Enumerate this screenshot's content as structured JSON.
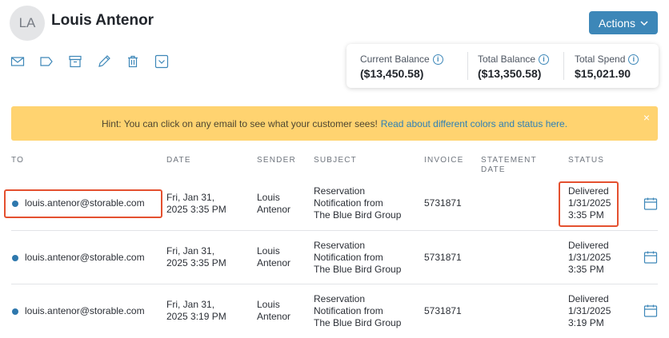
{
  "customer": {
    "initials": "LA",
    "name": "Louis Antenor"
  },
  "actions_label": "Actions",
  "toolbar": {
    "icons": [
      "mail-icon",
      "tag-icon",
      "archive-icon",
      "edit-pencil-icon",
      "trash-icon",
      "dropdown-checkbox-icon"
    ]
  },
  "balances": {
    "current": {
      "label": "Current Balance",
      "value": "($13,450.58)"
    },
    "total": {
      "label": "Total Balance",
      "value": "($13,350.58)"
    },
    "spend": {
      "label": "Total Spend",
      "value": "$15,021.90"
    }
  },
  "hint": {
    "text": "Hint: You can click on any email to see what your customer sees!",
    "link": "Read about different colors and status here.",
    "close": "×"
  },
  "table": {
    "headers": {
      "to": "TO",
      "date": "DATE",
      "sender": "SENDER",
      "subject": "SUBJECT",
      "invoice": "INVOICE",
      "statement_date_1": "STATEMENT",
      "statement_date_2": "DATE",
      "status": "STATUS"
    },
    "rows": [
      {
        "to": "louis.antenor@storable.com",
        "date_1": "Fri, Jan 31,",
        "date_2": "2025 3:35 PM",
        "sender_1": "Louis",
        "sender_2": "Antenor",
        "subject_1": "Reservation",
        "subject_2": "Notification from",
        "subject_3": "The Blue Bird Group",
        "invoice": "5731871",
        "status_1": "Delivered",
        "status_2": "1/31/2025",
        "status_3": "3:35 PM"
      },
      {
        "to": "louis.antenor@storable.com",
        "date_1": "Fri, Jan 31,",
        "date_2": "2025 3:35 PM",
        "sender_1": "Louis",
        "sender_2": "Antenor",
        "subject_1": "Reservation",
        "subject_2": "Notification from",
        "subject_3": "The Blue Bird Group",
        "invoice": "5731871",
        "status_1": "Delivered",
        "status_2": "1/31/2025",
        "status_3": "3:35 PM"
      },
      {
        "to": "louis.antenor@storable.com",
        "date_1": "Fri, Jan 31,",
        "date_2": "2025 3:19 PM",
        "sender_1": "Louis",
        "sender_2": "Antenor",
        "subject_1": "Reservation",
        "subject_2": "Notification from",
        "subject_3": "The Blue Bird Group",
        "invoice": "5731871",
        "status_1": "Delivered",
        "status_2": "1/31/2025",
        "status_3": "3:19 PM"
      }
    ]
  },
  "colors": {
    "accent": "#3d87b8",
    "hint_bg": "#ffd370",
    "highlight": "#e4502f",
    "dot": "#2e78ad"
  }
}
